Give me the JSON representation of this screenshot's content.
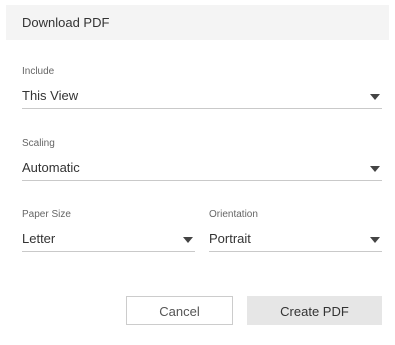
{
  "dialog": {
    "title": "Download PDF"
  },
  "include": {
    "label": "Include",
    "value": "This View",
    "icon": "chevron-down-icon"
  },
  "scaling": {
    "label": "Scaling",
    "value": "Automatic",
    "icon": "chevron-down-icon"
  },
  "paper_size": {
    "label": "Paper Size",
    "value": "Letter",
    "icon": "chevron-down-icon"
  },
  "orientation": {
    "label": "Orientation",
    "value": "Portrait",
    "icon": "chevron-down-icon"
  },
  "buttons": {
    "cancel": "Cancel",
    "create": "Create PDF"
  },
  "colors": {
    "header_bg": "#f4f4f4",
    "primary_button_bg": "#e6e6e6",
    "divider": "#c9c9c9"
  }
}
